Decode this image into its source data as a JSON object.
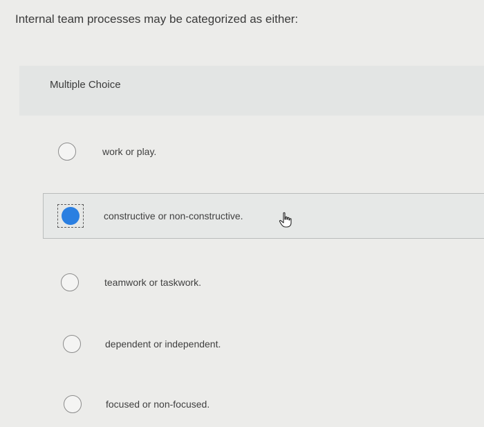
{
  "question": "Internal team processes may be categorized as either:",
  "section_label": "Multiple Choice",
  "options": [
    {
      "label": "work or play.",
      "selected": false
    },
    {
      "label": "constructive or non-constructive.",
      "selected": true
    },
    {
      "label": "teamwork or taskwork.",
      "selected": false
    },
    {
      "label": "dependent or independent.",
      "selected": false
    },
    {
      "label": "focused or non-focused.",
      "selected": false
    }
  ],
  "colors": {
    "selected_radio": "#2a7fe1",
    "background": "#ececea"
  },
  "icons": {
    "cursor": "hand-pointer-icon"
  }
}
